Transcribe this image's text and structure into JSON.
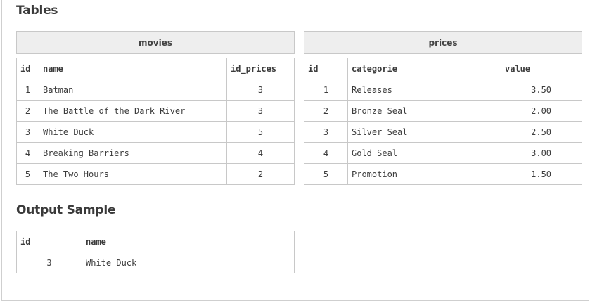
{
  "headings": {
    "tables": "Tables",
    "output": "Output Sample"
  },
  "movies": {
    "title": "movies",
    "columns": [
      "id",
      "name",
      "id_prices"
    ],
    "rows": [
      [
        "1",
        "Batman",
        "3"
      ],
      [
        "2",
        "The Battle of the Dark River",
        "3"
      ],
      [
        "3",
        "White Duck",
        "5"
      ],
      [
        "4",
        "Breaking Barriers",
        "4"
      ],
      [
        "5",
        "The Two Hours",
        "2"
      ]
    ]
  },
  "prices": {
    "title": "prices",
    "columns": [
      "id",
      "categorie",
      "value"
    ],
    "rows": [
      [
        "1",
        "Releases",
        "3.50"
      ],
      [
        "2",
        "Bronze Seal",
        "2.00"
      ],
      [
        "3",
        "Silver Seal",
        "2.50"
      ],
      [
        "4",
        "Gold Seal",
        "3.00"
      ],
      [
        "5",
        "Promotion",
        "1.50"
      ]
    ]
  },
  "output": {
    "columns": [
      "id",
      "name"
    ],
    "rows": [
      [
        "3",
        "White Duck"
      ]
    ]
  }
}
